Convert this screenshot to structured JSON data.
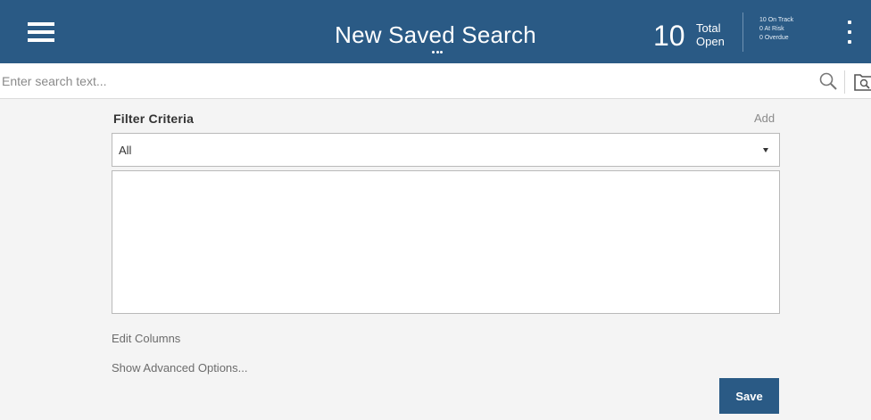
{
  "header": {
    "title": "New Saved Search",
    "menu_icon": "hamburger-menu-icon",
    "title_options_icon": "more-horizontal-icon",
    "total_count": "10",
    "total_label_line1": "Total",
    "total_label_line2": "Open",
    "status": [
      "10 On Track",
      "0 At Risk",
      "0 Overdue"
    ],
    "kebab_icon": "more-vertical-icon",
    "background_color": "#2a5a85"
  },
  "search": {
    "placeholder": "Enter search text...",
    "value": "",
    "search_icon": "search-icon",
    "saved_search_icon": "saved-search-icon"
  },
  "filter": {
    "label": "Filter Criteria",
    "add_label": "Add",
    "selected": "All",
    "dropdown_icon": "caret-down-icon"
  },
  "links": {
    "edit_columns": "Edit Columns",
    "advanced_options": "Show Advanced Options..."
  },
  "actions": {
    "save_label": "Save",
    "primary_color": "#2a5a85"
  }
}
